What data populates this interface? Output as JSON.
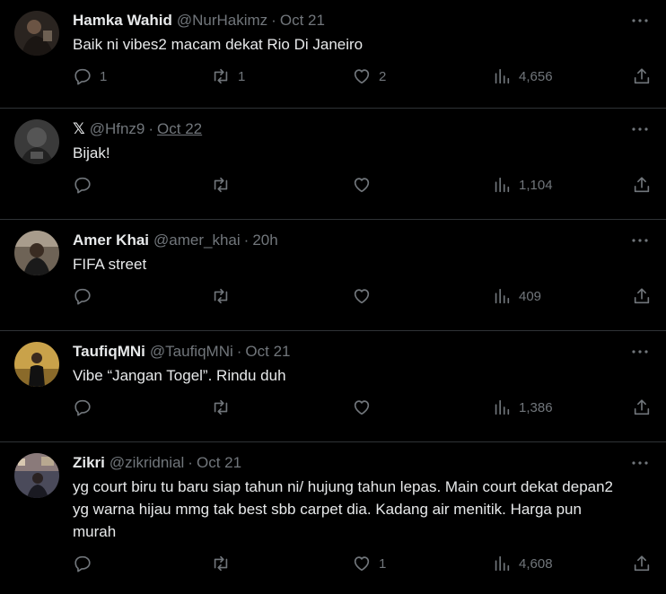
{
  "tweets": [
    {
      "name": "Hamka Wahid",
      "handle": "@NurHakimz",
      "dot": "·",
      "time": "Oct 21",
      "text": "Baik ni vibes2 macam dekat Rio Di Janeiro",
      "replies": "1",
      "retweets": "1",
      "likes": "2",
      "views": "4,656"
    },
    {
      "name": "𝕏",
      "handle": "@Hfnz9",
      "dot": "·",
      "time": "Oct 22",
      "text": "Bijak!",
      "replies": "",
      "retweets": "",
      "likes": "",
      "views": "1,104"
    },
    {
      "name": "Amer Khai",
      "handle": "@amer_khai",
      "dot": "·",
      "time": "20h",
      "text": "FIFA street",
      "replies": "",
      "retweets": "",
      "likes": "",
      "views": "409"
    },
    {
      "name": "TaufiqMNi",
      "handle": "@TaufiqMNi",
      "dot": "·",
      "time": "Oct 21",
      "text": "Vibe “Jangan Togel”. Rindu duh",
      "replies": "",
      "retweets": "",
      "likes": "",
      "views": "1,386"
    },
    {
      "name": "Zikri",
      "handle": "@zikridnial",
      "dot": "·",
      "time": "Oct 21",
      "text": "yg court biru tu baru siap tahun ni/ hujung tahun lepas. Main court dekat depan2 yg warna hijau mmg tak best sbb carpet dia. Kadang air menitik. Harga pun murah",
      "replies": "",
      "retweets": "",
      "likes": "1",
      "views": "4,608"
    }
  ],
  "colors": {
    "background": "#000000",
    "text": "#e7e9ea",
    "muted": "#71767b",
    "divider": "#2f3336"
  },
  "icons": [
    "reply-icon",
    "retweet-icon",
    "like-icon",
    "views-icon",
    "share-icon",
    "more-icon"
  ]
}
